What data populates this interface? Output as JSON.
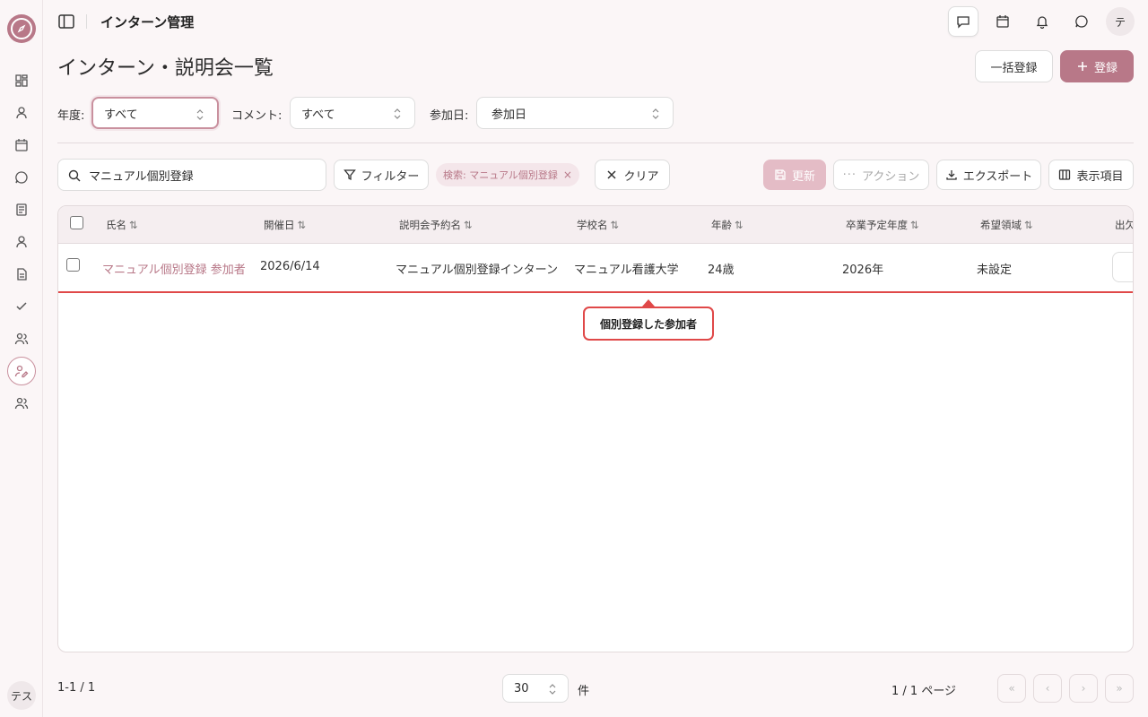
{
  "app": {
    "title": "インターン管理"
  },
  "sidebar": {
    "items": [
      {
        "icon": "dashboard-icon"
      },
      {
        "icon": "user-icon"
      },
      {
        "icon": "calendar-icon"
      },
      {
        "icon": "chat-icon"
      },
      {
        "icon": "document-icon"
      },
      {
        "icon": "person-icon"
      },
      {
        "icon": "file-icon"
      },
      {
        "icon": "check-icon"
      },
      {
        "icon": "users-icon"
      },
      {
        "icon": "intern-icon",
        "active": true
      },
      {
        "icon": "group-icon"
      }
    ],
    "user_initials": "テス"
  },
  "header": {
    "avatar_initial": "テ",
    "icons": [
      "message-square-icon",
      "calendar-icon",
      "bell-icon",
      "chat-bubble-icon"
    ]
  },
  "page": {
    "title": "インターン・説明会一覧",
    "bulk_register_label": "一括登録",
    "register_label": "登録"
  },
  "filters": {
    "year_label": "年度:",
    "year_value": "すべて",
    "comment_label": "コメント:",
    "comment_value": "すべて",
    "date_label": "参加日:",
    "date_value": "参加日"
  },
  "toolbar": {
    "search_value": "マニュアル個別登録",
    "filter_label": "フィルター",
    "chip_label": "検索: マニュアル個別登録",
    "clear_label": "クリア",
    "update_label": "更新",
    "action_label": "アクション",
    "export_label": "エクスポート",
    "columns_label": "表示項目"
  },
  "table": {
    "headers": [
      "氏名",
      "開催日",
      "説明会予約名",
      "学校名",
      "年齢",
      "卒業予定年度",
      "希望領域",
      "出欠"
    ],
    "sort_glyph": "⇅",
    "rows": [
      {
        "name": "マニュアル個別登録 参加者",
        "date": "2026/6/14",
        "session": "マニュアル個別登録インターン",
        "school": "マニュアル看護大学",
        "age": "24歳",
        "grad_year": "2026年",
        "field": "未設定"
      }
    ]
  },
  "callout": {
    "text": "個別登録した参加者"
  },
  "footer": {
    "count": "1-1 / 1",
    "per_page": "30",
    "unit": "件",
    "pages": "1 / 1 ページ"
  },
  "colors": {
    "accent": "#b87888",
    "highlight": "#e04848"
  }
}
